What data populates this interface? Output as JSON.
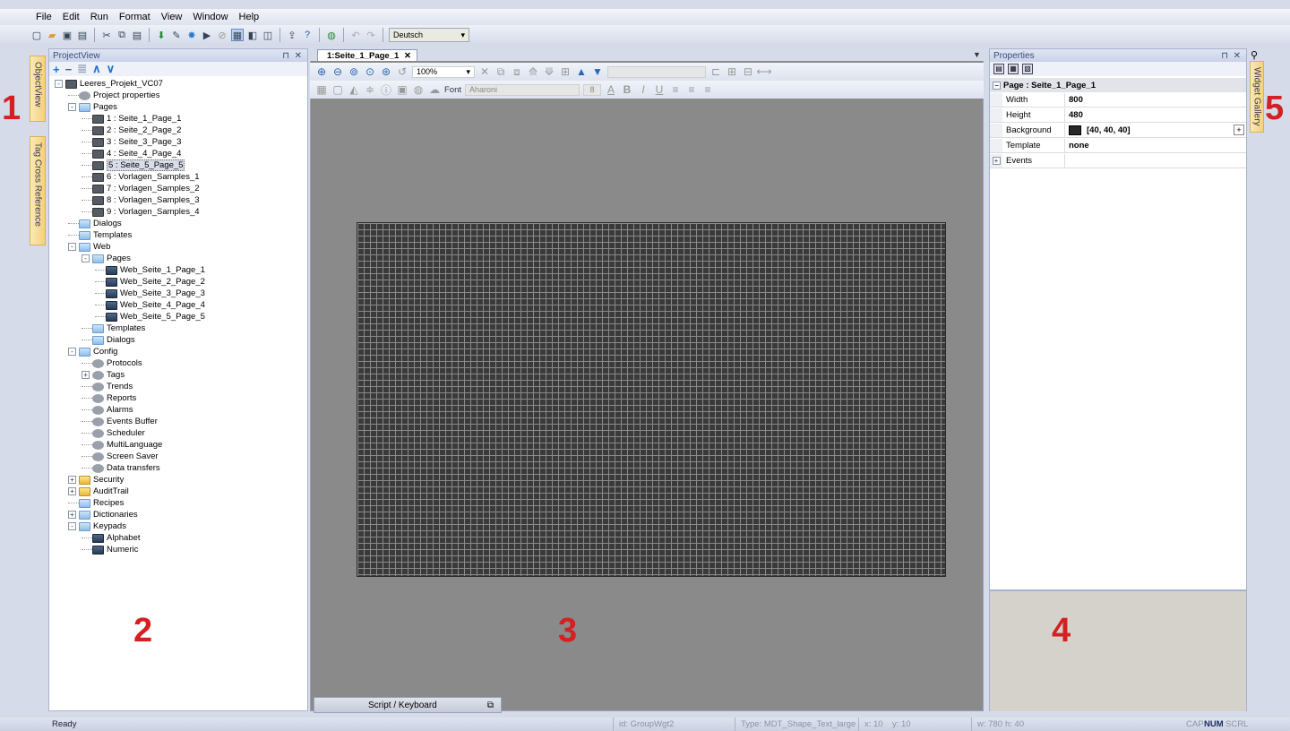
{
  "menu": [
    "File",
    "Edit",
    "Run",
    "Format",
    "View",
    "Window",
    "Help"
  ],
  "toolbar": {
    "language": "Deutsch"
  },
  "left_tabs": [
    "ObjectView",
    "Tag Cross Reference"
  ],
  "right_tabs": [
    "Widget Gallery"
  ],
  "project_view": {
    "title": "ProjectView",
    "tree": [
      {
        "label": "Leeres_Projekt_VC07",
        "depth": 0,
        "icon": "project-icon",
        "toggle": "-"
      },
      {
        "label": "Project properties",
        "depth": 1,
        "icon": "gear-icon"
      },
      {
        "label": "Pages",
        "depth": 1,
        "icon": "folder-icon",
        "toggle": "-"
      },
      {
        "label": "1 : Seite_1_Page_1",
        "depth": 2,
        "icon": "page-icon"
      },
      {
        "label": "2 : Seite_2_Page_2",
        "depth": 2,
        "icon": "page-icon"
      },
      {
        "label": "3 : Seite_3_Page_3",
        "depth": 2,
        "icon": "page-icon"
      },
      {
        "label": "4 : Seite_4_Page_4",
        "depth": 2,
        "icon": "page-icon"
      },
      {
        "label": "5 : Seite_5_Page_5",
        "depth": 2,
        "icon": "page-icon",
        "selected": true
      },
      {
        "label": "6 : Vorlagen_Samples_1",
        "depth": 2,
        "icon": "page-icon"
      },
      {
        "label": "7 : Vorlagen_Samples_2",
        "depth": 2,
        "icon": "page-icon"
      },
      {
        "label": "8 : Vorlagen_Samples_3",
        "depth": 2,
        "icon": "page-icon"
      },
      {
        "label": "9 : Vorlagen_Samples_4",
        "depth": 2,
        "icon": "page-icon"
      },
      {
        "label": "Dialogs",
        "depth": 1,
        "icon": "folder-icon"
      },
      {
        "label": "Templates",
        "depth": 1,
        "icon": "folder-icon"
      },
      {
        "label": "Web",
        "depth": 1,
        "icon": "folder-icon",
        "toggle": "-"
      },
      {
        "label": "Pages",
        "depth": 2,
        "icon": "folder-icon",
        "toggle": "-"
      },
      {
        "label": "Web_Seite_1_Page_1",
        "depth": 3,
        "icon": "web-page-icon"
      },
      {
        "label": "Web_Seite_2_Page_2",
        "depth": 3,
        "icon": "web-page-icon"
      },
      {
        "label": "Web_Seite_3_Page_3",
        "depth": 3,
        "icon": "web-page-icon"
      },
      {
        "label": "Web_Seite_4_Page_4",
        "depth": 3,
        "icon": "web-page-icon"
      },
      {
        "label": "Web_Seite_5_Page_5",
        "depth": 3,
        "icon": "web-page-icon"
      },
      {
        "label": "Templates",
        "depth": 2,
        "icon": "folder-icon"
      },
      {
        "label": "Dialogs",
        "depth": 2,
        "icon": "folder-icon"
      },
      {
        "label": "Config",
        "depth": 1,
        "icon": "folder-icon",
        "toggle": "-"
      },
      {
        "label": "Protocols",
        "depth": 2,
        "icon": "protocols-icon"
      },
      {
        "label": "Tags",
        "depth": 2,
        "icon": "tags-icon",
        "toggle": "+"
      },
      {
        "label": "Trends",
        "depth": 2,
        "icon": "trends-icon"
      },
      {
        "label": "Reports",
        "depth": 2,
        "icon": "reports-icon"
      },
      {
        "label": "Alarms",
        "depth": 2,
        "icon": "alarms-icon"
      },
      {
        "label": "Events Buffer",
        "depth": 2,
        "icon": "events-buffer-icon"
      },
      {
        "label": "Scheduler",
        "depth": 2,
        "icon": "scheduler-icon"
      },
      {
        "label": "MultiLanguage",
        "depth": 2,
        "icon": "multilanguage-icon"
      },
      {
        "label": "Screen Saver",
        "depth": 2,
        "icon": "screen-saver-icon"
      },
      {
        "label": "Data transfers",
        "depth": 2,
        "icon": "data-transfers-icon"
      },
      {
        "label": "Security",
        "depth": 1,
        "icon": "security-folder-icon",
        "toggle": "+"
      },
      {
        "label": "AuditTrail",
        "depth": 1,
        "icon": "audittrail-folder-icon",
        "toggle": "+"
      },
      {
        "label": "Recipes",
        "depth": 1,
        "icon": "folder-icon"
      },
      {
        "label": "Dictionaries",
        "depth": 1,
        "icon": "folder-icon",
        "toggle": "+"
      },
      {
        "label": "Keypads",
        "depth": 1,
        "icon": "folder-icon",
        "toggle": "-"
      },
      {
        "label": "Alphabet",
        "depth": 2,
        "icon": "keypad-icon"
      },
      {
        "label": "Numeric",
        "depth": 2,
        "icon": "keypad-icon"
      }
    ]
  },
  "editor": {
    "tab_label": "1:Seite_1_Page_1",
    "zoom": "100%",
    "font_label": "Font",
    "font_value": "Aharoni",
    "font_size": "8",
    "script_tab": "Script / Keyboard"
  },
  "properties": {
    "title": "Properties",
    "section": "Page : Seite_1_Page_1",
    "rows": [
      {
        "key": "Width",
        "value": "800"
      },
      {
        "key": "Height",
        "value": "480"
      },
      {
        "key": "Background",
        "value": "[40, 40, 40]",
        "swatch": "#282828"
      },
      {
        "key": "Template",
        "value": "none"
      },
      {
        "key": "Events",
        "value": ""
      }
    ]
  },
  "status": {
    "ready": "Ready",
    "id": "id: GroupWgt2",
    "type": "Type: MDT_Shape_Text_large",
    "x": "x: 10",
    "y": "y: 10",
    "w": "w: 780",
    "h": "h: 40",
    "cap": "CAP",
    "num": "NUM",
    "scrl": "SCRL"
  },
  "annotations": [
    "1",
    "2",
    "3",
    "4",
    "5"
  ],
  "colors": {
    "canvas": "#3a3a3a",
    "workspace": "#8a8a8a",
    "annotation": "#d42020",
    "sidetab": "#f4d17c"
  }
}
